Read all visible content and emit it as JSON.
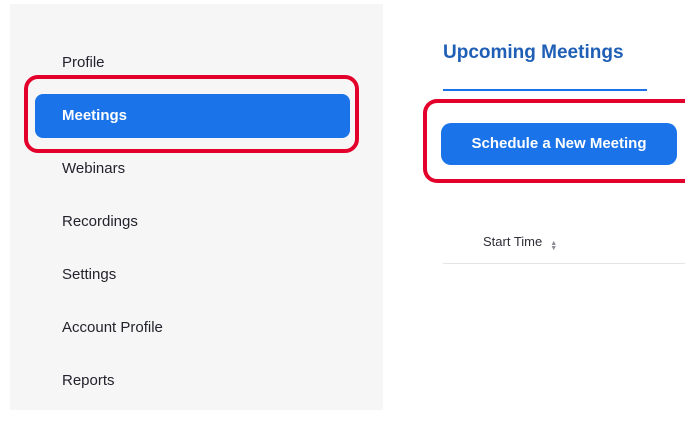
{
  "sidebar": {
    "items": [
      {
        "label": "Profile"
      },
      {
        "label": "Meetings",
        "active": true
      },
      {
        "label": "Webinars"
      },
      {
        "label": "Recordings"
      },
      {
        "label": "Settings"
      },
      {
        "label": "Account Profile"
      },
      {
        "label": "Reports"
      }
    ]
  },
  "main": {
    "tabs": [
      {
        "label": "Upcoming Meetings",
        "active": true
      }
    ],
    "schedule_button_label": "Schedule a New Meeting",
    "table": {
      "columns": [
        {
          "label": "Start Time",
          "sortable": true,
          "sort_icon": "sort-icon"
        }
      ]
    }
  },
  "colors": {
    "accent": "#1a73e8",
    "highlight": "#e3002b",
    "sidebar_bg": "#f6f6f6",
    "tab_text": "#1f5fb5"
  }
}
